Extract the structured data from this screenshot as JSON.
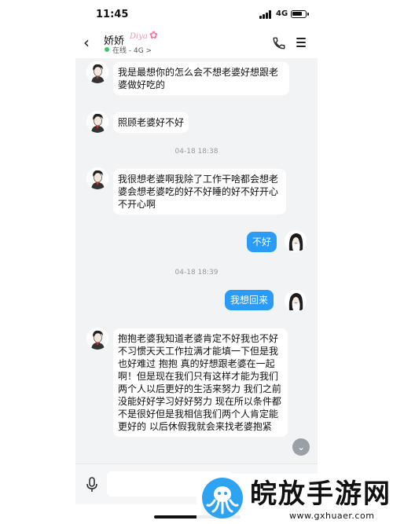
{
  "status_bar": {
    "time": "11:45",
    "network": "4G"
  },
  "header": {
    "back_icon": "chevron-left-icon",
    "contact_name": "娇娇",
    "vip_badge": "Diya",
    "status": "在线 - 4G >",
    "call_icon": "phone-icon",
    "menu_icon": "menu-icon"
  },
  "messages": [
    {
      "side": "in",
      "text": "我是最想你的怎么会不想老婆好想跟老婆做好吃的"
    },
    {
      "side": "in",
      "text": "照顾老婆好不好"
    },
    {
      "timestamp": "04-18 18:38"
    },
    {
      "side": "in",
      "text": "我很想老婆啊我除了工作干啥都会想老婆会想老婆吃的好不好睡的好不好开心不开心啊"
    },
    {
      "side": "out",
      "text": "不好"
    },
    {
      "timestamp": "04-18 18:39"
    },
    {
      "side": "out",
      "text": "我想回来"
    },
    {
      "side": "in",
      "text": "抱抱老婆我知道老婆肯定不好我也不好不习惯天天工作拉满才能填一下但是我也好难过 抱抱 真的好想跟老婆在一起啊！但是现在我们只有这样才能为我们两个人以后更好的生活来努力 我们之前没能好好学习好好努力 现在所以条件都不是很好但是我相信我们两个人肯定能更好的 以后休假我就会来找老婆抱紧"
    }
  ],
  "input_bar": {
    "mic_icon": "microphone-icon",
    "scroll_icon": "chevron-down-icon"
  },
  "watermark": {
    "title": "皖放手游网",
    "url": "www.gxhuaer.com"
  },
  "colors": {
    "outgoing_bubble": "#2a9cf7",
    "online": "#3cc76b",
    "chat_bg": "#f2f3f5"
  }
}
